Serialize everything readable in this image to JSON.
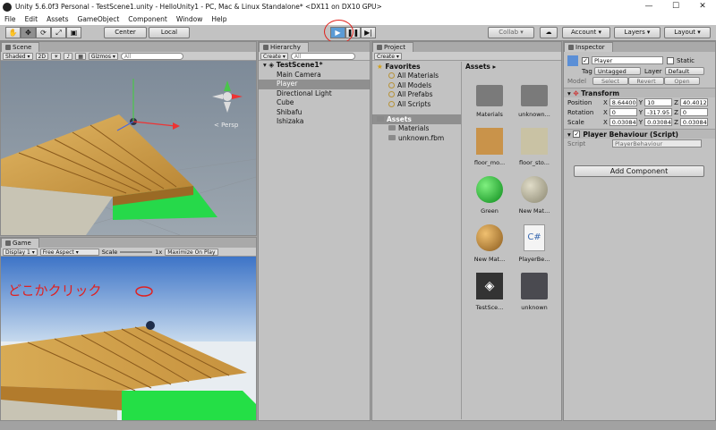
{
  "window": {
    "title": "Unity 5.6.0f3 Personal - TestScene1.unity - HelloUnity1 - PC, Mac & Linux Standalone* <DX11 on DX10 GPU>",
    "minimize": "—",
    "maximize": "☐",
    "close": "✕"
  },
  "menu": [
    "File",
    "Edit",
    "Assets",
    "GameObject",
    "Component",
    "Window",
    "Help"
  ],
  "toolbar": {
    "center_label": "Center",
    "local_label": "Local",
    "collab_label": "Collab ▾",
    "account_label": "Account ▾",
    "layers_label": "Layers ▾",
    "layout_label": "Layout ▾"
  },
  "scene": {
    "tab": "Scene",
    "shading": "Shaded ▾",
    "mode2d": "2D",
    "gizmos": "Gizmos ▾",
    "search": "All",
    "persp": "< Persp"
  },
  "game": {
    "tab": "Game",
    "display": "Display 1 ▾",
    "aspect": "Free Aspect ▾",
    "scale_label": "Scale",
    "scale_value": "1x",
    "maximize": "Maximize On Play",
    "overlay_text": "どこかクリック"
  },
  "hierarchy": {
    "tab": "Hierarchy",
    "create": "Create ▾",
    "search": "All",
    "scene_name": "TestScene1*",
    "items": [
      "Main Camera",
      "Player",
      "Directional Light",
      "Cube",
      "Shibafu",
      "Ishizaka"
    ]
  },
  "project": {
    "tab": "Project",
    "create": "Create ▾",
    "favorites": "Favorites",
    "fav_items": [
      "All Materials",
      "All Models",
      "All Prefabs",
      "All Scripts"
    ],
    "assets_head": "Assets",
    "asset_tree": [
      "Materials",
      "unknown.fbm"
    ],
    "breadcrumb": "Assets ▸",
    "grid": [
      "Materials",
      "unknown...",
      "floor_mo...",
      "floor_sto...",
      "Green",
      "New Mat...",
      "New Mat...",
      "PlayerBe...",
      "TestSce...",
      "unknown"
    ]
  },
  "inspector": {
    "tab": "Inspector",
    "object_name": "Player",
    "static_label": "Static",
    "tag_label": "Tag",
    "tag_value": "Untagged",
    "layer_label": "Layer",
    "layer_value": "Default",
    "model_label": "Model",
    "select": "Select",
    "revert": "Revert",
    "open": "Open",
    "transform": "Transform",
    "position_label": "Position",
    "rotation_label": "Rotation",
    "scale_label": "Scale",
    "position": [
      "8.64400",
      "10",
      "40.4012"
    ],
    "rotation": [
      "0",
      "-317.95",
      "0"
    ],
    "scale": [
      "0.03084",
      "0.03084",
      "0.03084"
    ],
    "axis_x": "X",
    "axis_y": "Y",
    "axis_z": "Z",
    "script_comp": "Player Behaviour (Script)",
    "script_label": "Script",
    "script_value": "PlayerBehaviour",
    "add_component": "Add Component"
  }
}
